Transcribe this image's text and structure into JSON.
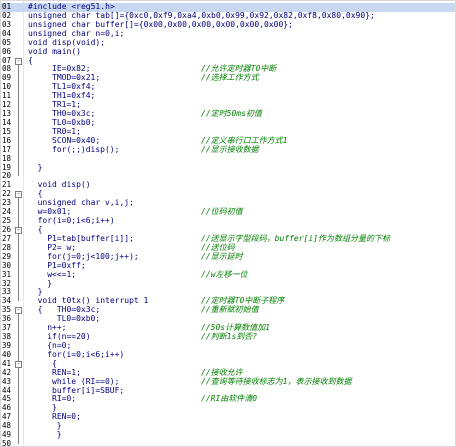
{
  "colors": {
    "code": "#000080",
    "comment": "#008000",
    "line_number": "#000000",
    "current_line_bg": "#c8d8f0"
  },
  "lines": [
    {
      "n": "01",
      "code": "#include <reg51.h>",
      "comment": "",
      "indent": 0
    },
    {
      "n": "02",
      "code": "unsigned char tab[]={0xc0,0xf9,0xa4,0xb0,0x99,0x92,0x82,0xf8,0x80,0x90};",
      "comment": "",
      "indent": 0
    },
    {
      "n": "03",
      "code": "unsigned char buffer[]={0x00,0x00,0x00,0x00,0x00,0x00};",
      "comment": "",
      "indent": 0
    },
    {
      "n": "04",
      "code": "unsigned char n=0,i;",
      "comment": "",
      "indent": 0
    },
    {
      "n": "05",
      "code": "void disp(void);",
      "comment": "",
      "indent": 0
    },
    {
      "n": "06",
      "code": "void main()",
      "comment": "",
      "indent": 0
    },
    {
      "n": "07",
      "code": "{",
      "comment": "",
      "indent": 0
    },
    {
      "n": "08",
      "code": "IE=0x82;",
      "comment": "//允许定时器T0中断",
      "indent": 5
    },
    {
      "n": "09",
      "code": "TMOD=0x21;",
      "comment": "//选择工作方式",
      "indent": 5
    },
    {
      "n": "10",
      "code": "TL1=0xf4;",
      "comment": "",
      "indent": 5
    },
    {
      "n": "11",
      "code": "TH1=0xf4;",
      "comment": "",
      "indent": 5
    },
    {
      "n": "12",
      "code": "TR1=1;",
      "comment": "",
      "indent": 5
    },
    {
      "n": "13",
      "code": "TH0=0x3c;",
      "comment": "//定时50ms初值",
      "indent": 5
    },
    {
      "n": "14",
      "code": "TL0=0xb0;",
      "comment": "",
      "indent": 5
    },
    {
      "n": "15",
      "code": "TR0=1;",
      "comment": "",
      "indent": 5
    },
    {
      "n": "16",
      "code": "SCON=0x40;",
      "comment": "//定义串行口工作方式1",
      "indent": 5
    },
    {
      "n": "17",
      "code": "for(;;)disp();",
      "comment": "//显示接收数据",
      "indent": 5
    },
    {
      "n": "18",
      "code": "",
      "comment": "",
      "indent": 0
    },
    {
      "n": "19",
      "code": "}",
      "comment": "",
      "indent": 2
    },
    {
      "n": "20",
      "code": "",
      "comment": "",
      "indent": 0
    },
    {
      "n": "21",
      "code": "void disp()",
      "comment": "",
      "indent": 2
    },
    {
      "n": "22",
      "code": "{",
      "comment": "",
      "indent": 2
    },
    {
      "n": "23",
      "code": "unsigned char v,i,j;",
      "comment": "",
      "indent": 2
    },
    {
      "n": "24",
      "code": "w=0x01;",
      "comment": "//位码初值",
      "indent": 2
    },
    {
      "n": "25",
      "code": "for(i=0;i<6;i++)",
      "comment": "",
      "indent": 2
    },
    {
      "n": "26",
      "code": "{",
      "comment": "",
      "indent": 2
    },
    {
      "n": "27",
      "code": "P1=tab[buffer[i]];",
      "comment": "//送显示字型段码，buffer[i]作为数组分量的下标",
      "indent": 4
    },
    {
      "n": "28",
      "code": "P2= w;",
      "comment": "//送位码",
      "indent": 4
    },
    {
      "n": "29",
      "code": "for(j=0;j<100;j++);",
      "comment": "//显示延时",
      "indent": 4
    },
    {
      "n": "30",
      "code": "P1=0xff;",
      "comment": "",
      "indent": 4
    },
    {
      "n": "31",
      "code": "w<<=1;",
      "comment": "//w左移一位",
      "indent": 4
    },
    {
      "n": "32",
      "code": "}",
      "comment": "",
      "indent": 4
    },
    {
      "n": "33",
      "code": "}",
      "comment": "",
      "indent": 2
    },
    {
      "n": "34",
      "code": "void t0tx() interrupt 1",
      "comment": "//定时器T0中断子程序",
      "indent": 2
    },
    {
      "n": "35",
      "code": "{   TH0=0x3c;",
      "comment": "//重新赋初始值",
      "indent": 2
    },
    {
      "n": "36",
      "code": "TL0=0xb0;",
      "comment": "",
      "indent": 6
    },
    {
      "n": "37",
      "code": "n++;",
      "comment": "//50s计算数值加1",
      "indent": 4
    },
    {
      "n": "38",
      "code": "if(n==20)",
      "comment": "//判断1s到否?",
      "indent": 4
    },
    {
      "n": "39",
      "code": "{n=0;",
      "comment": "",
      "indent": 4
    },
    {
      "n": "40",
      "code": "for(i=0;i<6;i++)",
      "comment": "",
      "indent": 4
    },
    {
      "n": "41",
      "code": "{",
      "comment": "",
      "indent": 5
    },
    {
      "n": "42",
      "code": "REN=1;",
      "comment": "//接收允许",
      "indent": 5
    },
    {
      "n": "43",
      "code": "while (RI==0);",
      "comment": "//查询等待接收标志为1，表示接收到数据",
      "indent": 5
    },
    {
      "n": "44",
      "code": "buffer[i]=SBUF;",
      "comment": "",
      "indent": 5
    },
    {
      "n": "45",
      "code": "RI=0;",
      "comment": "//RI由软件清0",
      "indent": 5
    },
    {
      "n": "46",
      "code": "}",
      "comment": "",
      "indent": 5
    },
    {
      "n": "47",
      "code": "REN=0;",
      "comment": "",
      "indent": 5
    },
    {
      "n": "48",
      "code": "}",
      "comment": "",
      "indent": 6
    },
    {
      "n": "49",
      "code": "}",
      "comment": "",
      "indent": 6
    },
    {
      "n": "50",
      "code": "",
      "comment": "",
      "indent": 0
    }
  ]
}
